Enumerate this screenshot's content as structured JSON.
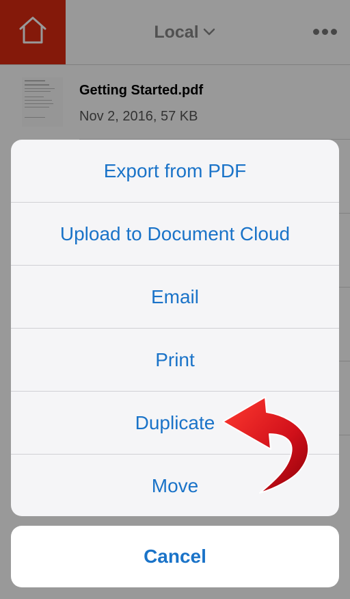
{
  "header": {
    "title": "Local",
    "icons": {
      "home": "home-icon",
      "dropdown": "chevron-down-icon",
      "more": "more-horizontal-icon"
    },
    "accent_color": "#dd2a12"
  },
  "file": {
    "name": "Getting Started.pdf",
    "meta": "Nov 2, 2016, 57 KB"
  },
  "action_sheet": {
    "items": [
      "Export from PDF",
      "Upload to Document Cloud",
      "Email",
      "Print",
      "Duplicate",
      "Move"
    ],
    "cancel": "Cancel",
    "text_color": "#1a73c8"
  },
  "annotation": {
    "icon": "curved-arrow-icon",
    "color": "#d0101a",
    "points_to": "Duplicate"
  }
}
